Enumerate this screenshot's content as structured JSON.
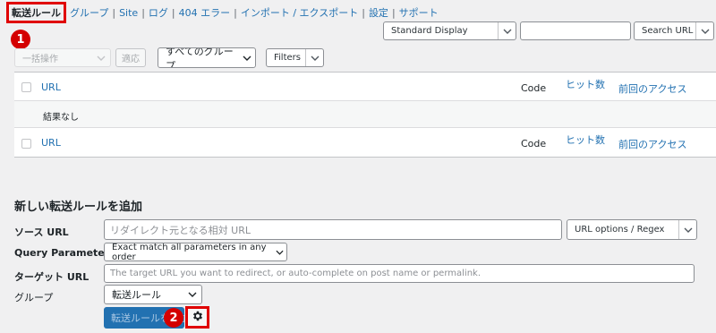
{
  "nav": {
    "items": [
      {
        "label": "転送ルール",
        "current": true
      },
      {
        "label": "グループ"
      },
      {
        "label": "Site"
      },
      {
        "label": "ログ"
      },
      {
        "label": "404 エラー"
      },
      {
        "label": "インポート / エクスポート"
      },
      {
        "label": "設定"
      },
      {
        "label": "サポート"
      }
    ],
    "separator": "|"
  },
  "badges": {
    "first": "1",
    "second": "2"
  },
  "display_select": {
    "value": "Standard Display"
  },
  "search": {
    "placeholder": "",
    "button_label": "Search URL"
  },
  "bulk": {
    "select_value": "一括操作",
    "apply_label": "適応"
  },
  "group_filter": {
    "value": "すべてのグループ"
  },
  "filters": {
    "label": "Filters"
  },
  "table": {
    "columns": {
      "url": "URL",
      "code": "Code",
      "hits": "ヒット数",
      "last_access": "前回のアクセス"
    },
    "empty_text": "結果なし"
  },
  "add_form": {
    "title": "新しい転送ルールを追加",
    "source_label": "ソース URL",
    "source_placeholder": "リダイレクト元となる相対 URL",
    "url_options": "URL options / Regex",
    "query_label": "Query Parameters",
    "query_value": "Exact match all parameters in any order",
    "target_label": "ターゲット URL",
    "target_placeholder": "The target URL you want to redirect, or auto-complete on post name or permalink.",
    "group_label": "グループ",
    "group_value": "転送ルール",
    "submit_label": "転送ルールを追加"
  },
  "colors": {
    "accent": "#2271b1",
    "highlight": "#e00000"
  }
}
